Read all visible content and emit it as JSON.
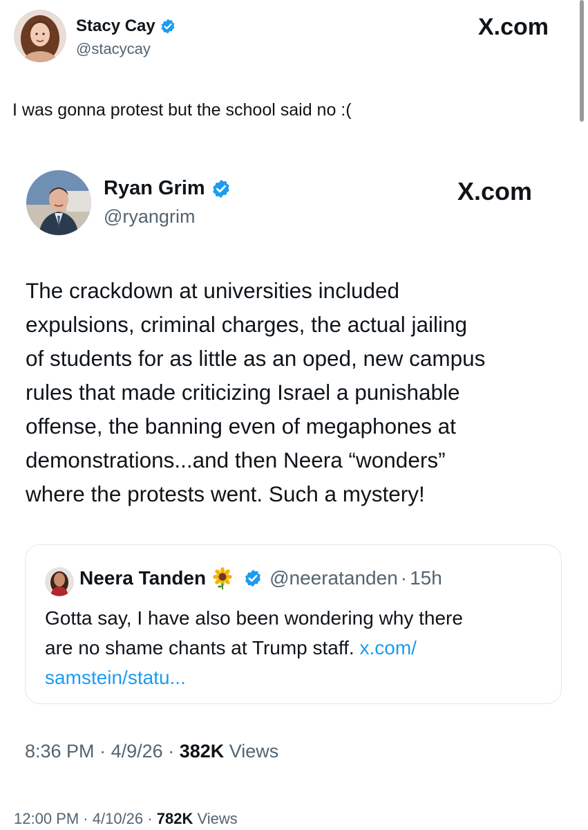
{
  "outer_tweet": {
    "display_name": "Stacy Cay",
    "handle": "@stacycay",
    "source_label": "X.com",
    "text": "I was gonna protest but the school said no :(",
    "time": "12:00 PM",
    "date": "4/10/26",
    "views_count": "782K",
    "views_label": "Views",
    "separator": "·"
  },
  "inner_tweet": {
    "display_name": "Ryan Grim",
    "handle": "@ryangrim",
    "source_label": "X.com",
    "text_lines": [
      "The crackdown at universities included",
      "expulsions, criminal charges, the actual jailing",
      "of students for as little as an oped, new campus",
      "rules that made criticizing Israel a punishable",
      "offense, the banning even of megaphones at",
      "demonstrations...and then Neera “wonders”",
      "where the protests went. Such a mystery!"
    ],
    "time": "8:36 PM",
    "date": "4/9/26",
    "views_count": "382K",
    "views_label": "Views",
    "separator": "·"
  },
  "quoted_tweet": {
    "display_name": "Neera Tanden",
    "emoji": "🌻",
    "handle": "@neeratanden",
    "separator": "·",
    "age": "15h",
    "text_line1": "Gotta say, I have also been wondering why there",
    "text_line2": "are no shame chants at Trump staff. ",
    "link_part1": "x.com/",
    "link_part2": "samstein/statu..."
  },
  "colors": {
    "verified": "#1d9bf0",
    "link": "#1d9bf0",
    "muted": "#536471",
    "text": "#0f1419"
  }
}
